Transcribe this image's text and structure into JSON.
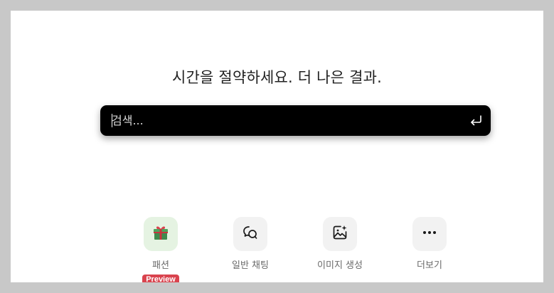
{
  "headline": "시간을 절약하세요. 더 나은 결과.",
  "search": {
    "placeholder": "검색...",
    "value": ""
  },
  "shortcuts": [
    {
      "label": "패션",
      "icon": "gift-icon",
      "badge": "Preview"
    },
    {
      "label": "일반 채팅",
      "icon": "chat-bubbles-icon"
    },
    {
      "label": "이미지 생성",
      "icon": "image-sparkle-icon"
    },
    {
      "label": "더보기",
      "icon": "more-dots-icon"
    }
  ],
  "colors": {
    "search_bg": "#000000",
    "badge_bg": "#d9434e",
    "fashion_tile_bg": "#e5f3e2",
    "tile_bg": "#f2f2f2"
  }
}
